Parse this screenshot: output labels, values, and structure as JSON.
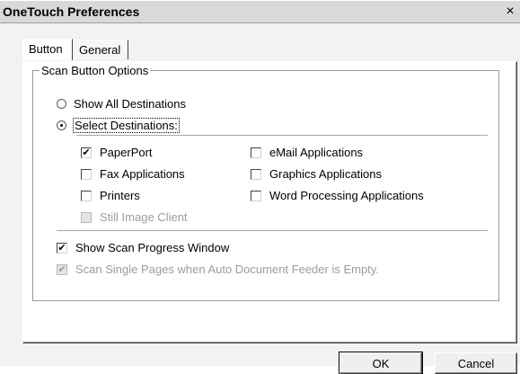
{
  "window": {
    "title": "OneTouch Preferences",
    "close_glyph": "×"
  },
  "tabs": [
    {
      "label": "Button",
      "active": true
    },
    {
      "label": "General",
      "active": false
    }
  ],
  "scan_group": {
    "legend": "Scan Button Options",
    "radios": [
      {
        "label": "Show All Destinations",
        "checked": false
      },
      {
        "label": "Select Destinations:",
        "checked": true
      }
    ],
    "destinations_left": [
      {
        "label": "PaperPort",
        "checked": true,
        "enabled": true
      },
      {
        "label": "Fax Applications",
        "checked": false,
        "enabled": true
      },
      {
        "label": "Printers",
        "checked": false,
        "enabled": true
      },
      {
        "label": "Still Image Client",
        "checked": false,
        "enabled": false
      }
    ],
    "destinations_right": [
      {
        "label": "eMail Applications",
        "checked": false,
        "enabled": true
      },
      {
        "label": "Graphics Applications",
        "checked": false,
        "enabled": true
      },
      {
        "label": "Word Processing Applications",
        "checked": false,
        "enabled": true
      }
    ],
    "options": [
      {
        "label": "Show Scan Progress Window",
        "checked": true,
        "enabled": true
      },
      {
        "label": "Scan Single Pages when Auto Document Feeder is Empty.",
        "checked": true,
        "enabled": false
      }
    ]
  },
  "buttons": {
    "ok": "OK",
    "cancel": "Cancel"
  },
  "glyphs": {
    "check": "✔"
  }
}
